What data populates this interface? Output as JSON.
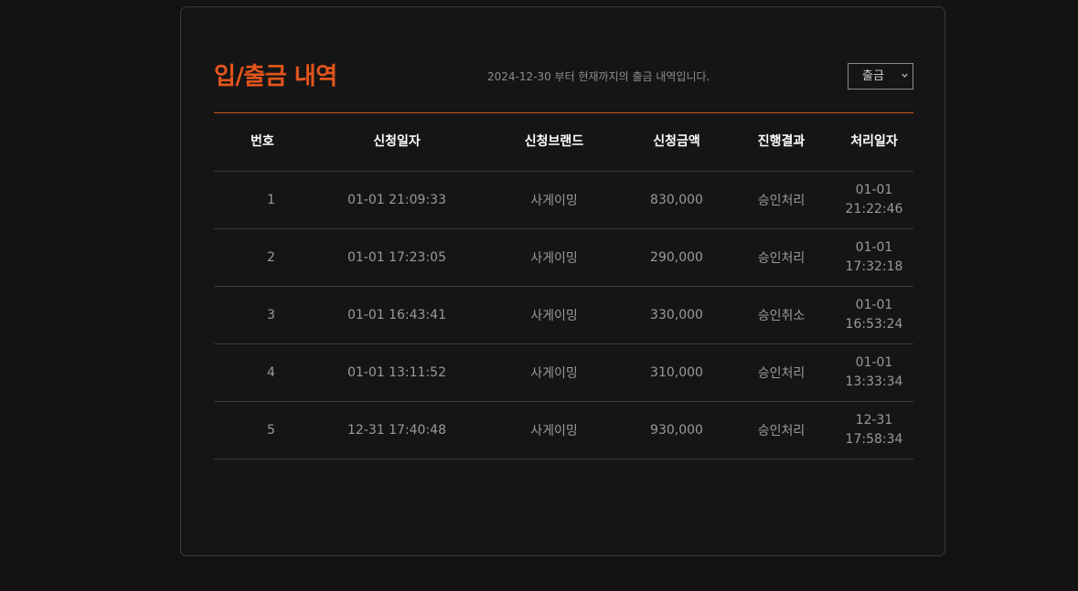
{
  "header": {
    "title": "입/출금 내역",
    "subtitle": "2024-12-30 부터 현재까지의 출금 내역입니다.",
    "select_value": "출금"
  },
  "table": {
    "columns": [
      "번호",
      "신청일자",
      "신청브랜드",
      "신청금액",
      "진행결과",
      "처리일자"
    ],
    "rows": [
      {
        "no": "1",
        "date": "01-01 21:09:33",
        "brand": "사게이밍",
        "amount": "830,000",
        "result": "승인처리",
        "processed_date": "01-01",
        "processed_time": "21:22:46"
      },
      {
        "no": "2",
        "date": "01-01 17:23:05",
        "brand": "사게이밍",
        "amount": "290,000",
        "result": "승인처리",
        "processed_date": "01-01",
        "processed_time": "17:32:18"
      },
      {
        "no": "3",
        "date": "01-01 16:43:41",
        "brand": "사게이밍",
        "amount": "330,000",
        "result": "승인취소",
        "processed_date": "01-01",
        "processed_time": "16:53:24"
      },
      {
        "no": "4",
        "date": "01-01 13:11:52",
        "brand": "사게이밍",
        "amount": "310,000",
        "result": "승인처리",
        "processed_date": "01-01",
        "processed_time": "13:33:34"
      },
      {
        "no": "5",
        "date": "12-31 17:40:48",
        "brand": "사게이밍",
        "amount": "930,000",
        "result": "승인처리",
        "processed_date": "12-31",
        "processed_time": "17:58:34"
      }
    ]
  },
  "colors": {
    "accent": "#e2551c",
    "background": "#131313",
    "text_muted": "#9a9a9a"
  }
}
